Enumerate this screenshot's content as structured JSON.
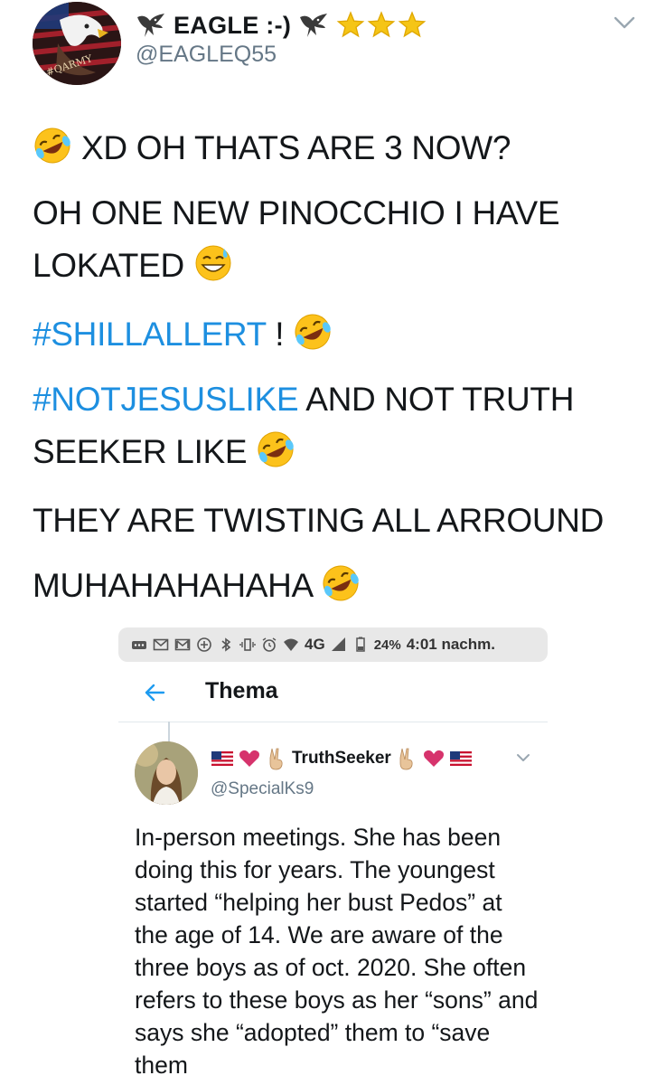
{
  "tweet": {
    "display_name": "EAGLE :-)",
    "handle": "@EAGLEQ55",
    "avatar_badge": "#QARMY",
    "lines": {
      "l1": "XD OH THATS ARE 3 NOW?",
      "l2a": "OH ONE NEW PINOCCHIO I HAVE",
      "l2b": "LOKATED",
      "hashtag1": "#SHILLALLERT",
      "l3_tail": " ! ",
      "hashtag2": "#NOTJESUSLIKE",
      "l4_tail": " AND NOT TRUTH",
      "l4b": "SEEKER LIKE",
      "l5": "THEY ARE TWISTING ALL ARROUND",
      "l6": "MUHAHAHAHAHA"
    },
    "colors": {
      "hashtag": "#1d8fe0",
      "handle": "#657786",
      "text": "#14171a"
    },
    "icons": [
      "eagle-icon",
      "star-icon",
      "chevron-down-icon",
      "rofl-emoji",
      "sweat-smile-emoji"
    ]
  },
  "embedded_screenshot": {
    "status_bar": {
      "network": "4G",
      "battery": "24%",
      "time": "4:01 nachm."
    },
    "header": {
      "title": "Thema"
    },
    "reply": {
      "display_name": "TruthSeeker",
      "handle": "@SpecialKs9",
      "text": "In-person meetings. She has been doing this for years. The youngest started “helping her bust Pedos” at the age of 14. We are aware of the three boys as of oct. 2020. She often refers to these boys as her “sons” and says she “adopted” them to “save them"
    }
  }
}
